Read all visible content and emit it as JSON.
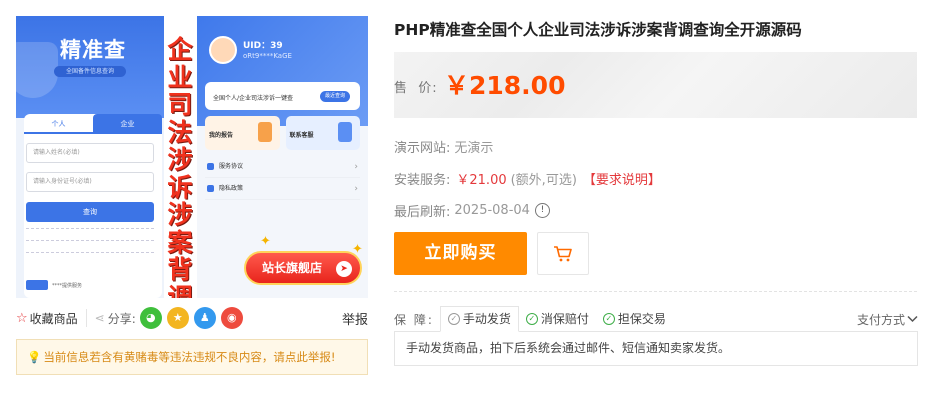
{
  "product_image": {
    "left_screen": {
      "brand": "精准查",
      "subtitle": "全国备件信息查询",
      "tab_personal": "个人",
      "tab_company": "企业",
      "name_placeholder": "请输入姓名(必填)",
      "id_placeholder": "请输入身份证号(必填)",
      "query_button": "查询",
      "bottom_text": "****提供服务"
    },
    "vertical_text": [
      "企",
      "业",
      "司",
      "法",
      "涉",
      "诉",
      "涉",
      "案",
      "背",
      "调"
    ],
    "right_screen": {
      "uid": "UID：39",
      "nickname": "oRt9****KaGE",
      "card_text": "全国个人/企业司法涉诉一键查",
      "card_button": "最近查询",
      "tile_reports": "我的报告",
      "tile_support": "联系客服",
      "menu_items": [
        "服务协议",
        "隐私政策"
      ]
    },
    "stamp_text": "站长旗舰店",
    "stamp_arrow": "➤"
  },
  "action_bar": {
    "favorite_label": "收藏商品",
    "share_label": "分享:",
    "share_icons": [
      "wechat-icon",
      "qzone-icon",
      "qq-icon",
      "weibo-icon"
    ],
    "report_label": "举报"
  },
  "notice": {
    "text": "当前信息若含有黄赌毒等违法违规不良内容，请点此举报!"
  },
  "product": {
    "title": "PHP精准查全国个人企业司法涉诉涉案背调查询全开源源码",
    "price_label": "售  价:",
    "price": "￥218.00"
  },
  "info": {
    "demo_label": "演示网站:",
    "demo_value": "无演示",
    "install_label": "安装服务:",
    "install_price": "￥21.00",
    "install_extra": "(额外,可选)",
    "install_requirement": "【要求说明】",
    "refresh_label": "最后刷新:",
    "refresh_date": "2025-08-04"
  },
  "actions": {
    "buy_now": "立即购买"
  },
  "guarantee": {
    "label": "保 障:",
    "tabs": [
      "手动发货",
      "消保赔付",
      "担保交易"
    ],
    "pay_method": "支付方式",
    "description": "手动发货商品，拍下后系统会通过邮件、短信通知卖家发货。"
  },
  "colors": {
    "price": "#ff4c00",
    "buy_button": "#ff8a00",
    "warning": "#e4393c",
    "check_green": "#3fae49"
  }
}
